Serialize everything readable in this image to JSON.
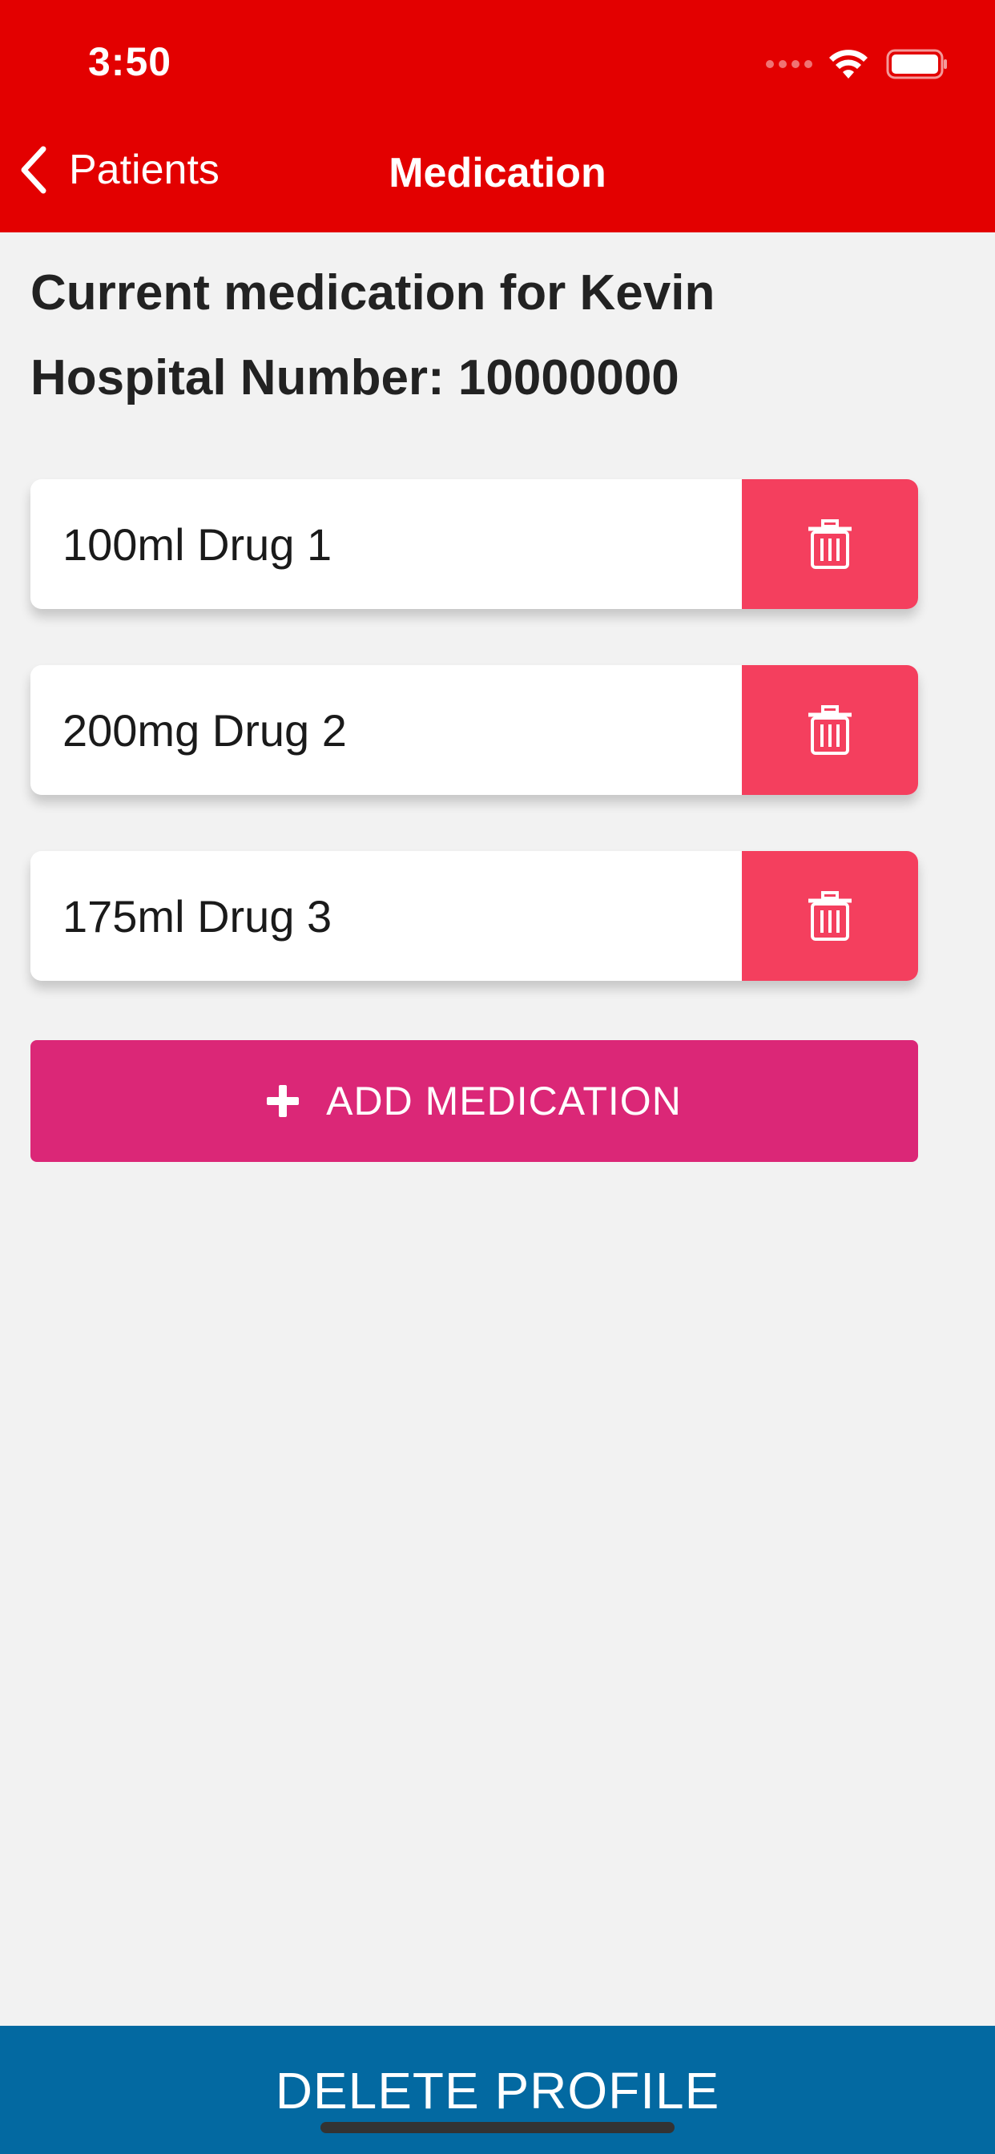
{
  "status_bar": {
    "time": "3:50"
  },
  "nav": {
    "back_label": "Patients",
    "title": "Medication"
  },
  "content": {
    "heading": "Current medication for Kevin",
    "hospital_number": "Hospital Number: 10000000",
    "medications": [
      {
        "label": "100ml Drug 1"
      },
      {
        "label": "200mg Drug 2"
      },
      {
        "label": "175ml Drug 3"
      }
    ],
    "add_button_label": "ADD MEDICATION"
  },
  "footer": {
    "delete_profile_label": "DELETE PROFILE"
  },
  "colors": {
    "header": "#e30000",
    "delete_button": "#f43f5e",
    "add_button": "#db2777",
    "footer": "#0369a1"
  },
  "icons": {
    "back": "chevron-left-icon",
    "delete": "trash-icon",
    "add": "plus-icon",
    "wifi": "wifi-icon",
    "battery": "battery-icon"
  }
}
